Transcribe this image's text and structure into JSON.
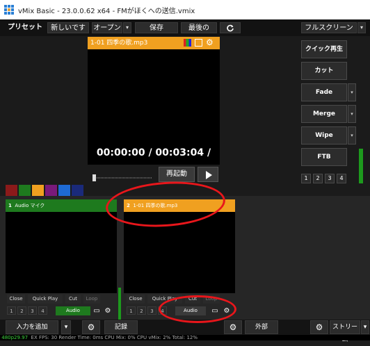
{
  "window": {
    "title": "vMix Basic - 23.0.0.62 x64 - FMがほくへの送信.vmix"
  },
  "menubar": {
    "preset": "プリセット",
    "new": "新しいです",
    "open": "オープン",
    "save": "保存",
    "recent": "最後の",
    "fullscreen": "フルスクリーン",
    "caret": "▾"
  },
  "preview": {
    "title": "1-01 四季の歌.mp3",
    "timecode": "00:00:00 / 00:03:04 /",
    "restart": "再起動",
    "progress": 0.0
  },
  "transitions": {
    "quickplay": "クイック再生",
    "cut": "カット",
    "fade": "Fade",
    "merge": "Merge",
    "wipe": "Wipe",
    "ftb": "FTB",
    "nums": [
      "1",
      "2",
      "3",
      "4"
    ]
  },
  "color_tabs": [
    "#8b1a1a",
    "#1e7a1e",
    "#f0a020",
    "#7a1a7a",
    "#1e6ad4",
    "#1a2a7a"
  ],
  "inputs": [
    {
      "number": "1",
      "name": "Audio マイク",
      "color": "#1e7a1e"
    },
    {
      "number": "2",
      "name": "1-01 四季の歌.mp3",
      "color": "#f0a020"
    }
  ],
  "input_controls": {
    "close": "Close",
    "quickplay": "Quick Play",
    "cut": "Cut",
    "loop": "Loop",
    "audio": "Audio",
    "nums": [
      "1",
      "2",
      "3",
      "4"
    ]
  },
  "bottombar": {
    "add_input": "入力を追加",
    "record": "記録",
    "external": "外部",
    "stream": "ストリーム",
    "caret": "▾"
  },
  "status": {
    "time": "480p29.97",
    "rest": "EX  FPS: 30  Render Time: 0ms  CPU Mix: 0%  CPU vMix: 2%  Total: 12%"
  }
}
